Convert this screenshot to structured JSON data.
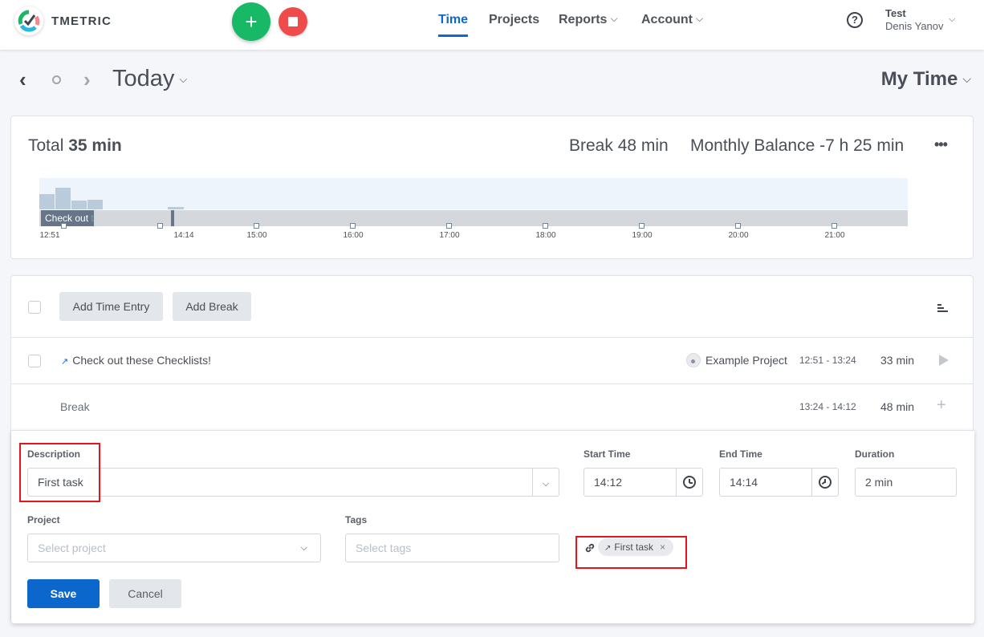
{
  "header": {
    "brand": "TMETRIC",
    "add_button_label": "+",
    "nav": [
      {
        "label": "Time",
        "active": true,
        "dropdown": false
      },
      {
        "label": "Projects",
        "active": false,
        "dropdown": false
      },
      {
        "label": "Reports",
        "active": false,
        "dropdown": true
      },
      {
        "label": "Account",
        "active": false,
        "dropdown": true
      }
    ],
    "help_icon": "?",
    "user": {
      "workspace": "Test",
      "name": "Denis Yanov"
    }
  },
  "datebar": {
    "period_label": "Today",
    "view_label": "My Time",
    "prev_icon": "‹",
    "next_icon": "›"
  },
  "summary": {
    "total_label": "Total",
    "total_value": "35 min",
    "break_label": "Break",
    "break_value": "48 min",
    "balance_label": "Monthly Balance",
    "balance_value": "-7 h 25 min",
    "more_icon": "•••",
    "timeline": {
      "entry_label": "Check out",
      "entry_label_fade": " t",
      "ticks": [
        "12:51",
        "14:14",
        "15:00",
        "16:00",
        "17:00",
        "18:00",
        "19:00",
        "20:00",
        "21:00"
      ]
    }
  },
  "toolbar": {
    "add_time_entry": "Add Time Entry",
    "add_break": "Add Break"
  },
  "entries": [
    {
      "description": "Check out these Checklists!",
      "project": "Example Project",
      "time_range": "12:51 - 13:24",
      "duration": "33 min"
    },
    {
      "description": "Break",
      "time_range": "13:24 - 14:12",
      "duration": "48 min"
    }
  ],
  "form": {
    "description_label": "Description",
    "description_value": "First task",
    "start_label": "Start Time",
    "start_value": "14:12",
    "end_label": "End Time",
    "end_value": "14:14",
    "duration_label": "Duration",
    "duration_value": "2 min",
    "project_label": "Project",
    "project_placeholder": "Select project",
    "tags_label": "Tags",
    "tags_placeholder": "Select tags",
    "linked_task": "First task",
    "remove_icon": "×",
    "save_label": "Save",
    "cancel_label": "Cancel"
  },
  "colors": {
    "accent": "#1067cc",
    "start_green": "#17b866",
    "stop_red": "#f04b4b",
    "highlight_red": "#e8141c"
  }
}
